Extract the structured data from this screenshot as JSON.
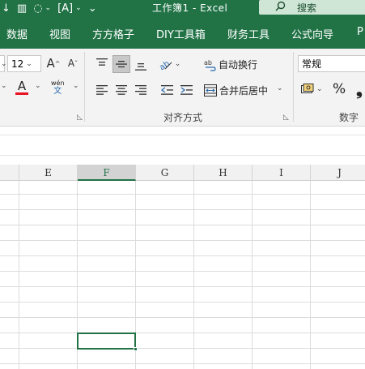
{
  "titlebar": {
    "title": "工作簿1  -  Excel",
    "search_placeholder": "搜索",
    "qat": {
      "undo_glyph": "↓",
      "chart_glyph": "▥",
      "shape_glyph": "◌",
      "textbox_glyph": "[A]",
      "more_glyph": "⌄"
    }
  },
  "tabs": [
    "数据",
    "视图",
    "方方格子",
    "DIY工具箱",
    "财务工具",
    "公式向导",
    "P"
  ],
  "ribbon": {
    "font_size": "12",
    "grow_font": "A",
    "shrink_font": "A",
    "font_color_letter": "A",
    "phonetic_top": "wén",
    "phonetic_bottom": "文",
    "wrap_text": "自动换行",
    "merge_center": "合并后居中",
    "number_format": "常规",
    "percent": "%",
    "comma": "❟",
    "alignment_group": "对齐方式",
    "number_group": "数字",
    "launcher_glyph": "◺"
  },
  "grid": {
    "columns": [
      "E",
      "F",
      "G",
      "H",
      "I",
      "J"
    ],
    "selected_column": "F"
  },
  "colors": {
    "excel_green": "#217346",
    "font_color_red": "#e81123"
  }
}
